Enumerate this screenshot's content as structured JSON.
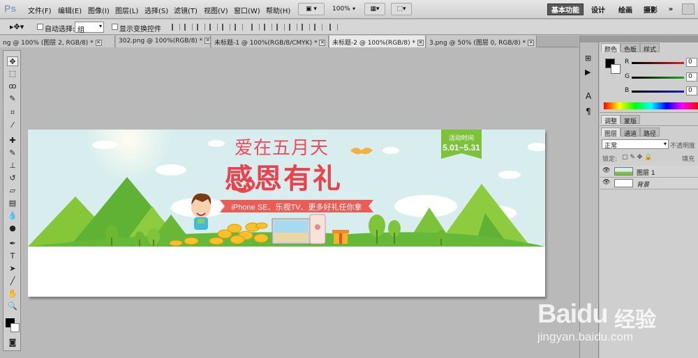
{
  "app": {
    "logo": "Ps"
  },
  "menu": [
    "文件(F)",
    "编辑(E)",
    "图像(I)",
    "图层(L)",
    "选择(S)",
    "滤镜(T)",
    "视图(V)",
    "窗口(W)",
    "帮助(H)"
  ],
  "menubar_controls": {
    "zoom": "100%"
  },
  "workspaces": [
    "基本功能",
    "设计",
    "绘画",
    "摄影",
    "»"
  ],
  "options": {
    "auto_select_label": "自动选择:",
    "auto_select_value": "组",
    "show_transform_label": "显示变换控件"
  },
  "tabs": [
    {
      "label": "ng @ 100% (图层 2, RGB/8) *",
      "active": false
    },
    {
      "label": "302.png @ 100%(RGB/8) *",
      "active": false
    },
    {
      "label": "未标题-1 @ 100%(RGB/8/CMYK) *",
      "active": false
    },
    {
      "label": "未标题-2 @ 100%(RGB/8) *",
      "active": true
    },
    {
      "label": "3.png @ 50% (图层 0, RGB/8) *",
      "active": false
    }
  ],
  "banner": {
    "line1": "爱在五月天",
    "line2": "感恩有礼",
    "ribbon": "iPhone SE、乐视TV、更多好礼任你拿",
    "badge_title": "活动时间",
    "badge_dates": "5.01~5.31"
  },
  "color_panel": {
    "tabs": [
      "颜色",
      "色板",
      "样式"
    ],
    "channels": [
      {
        "label": "R",
        "value": "0",
        "color": "#e41d1d"
      },
      {
        "label": "G",
        "value": "0",
        "color": "#1fa51f"
      },
      {
        "label": "B",
        "value": "0",
        "color": "#1c1cc8"
      }
    ]
  },
  "adjust_panel": {
    "tabs": [
      "调整",
      "蒙版"
    ]
  },
  "layers_panel": {
    "tabs": [
      "图层",
      "通道",
      "路径"
    ],
    "blend_mode": "正常",
    "opacity_label": "不透明度",
    "lock_label": "锁定:",
    "fill_label": "填充",
    "layers": [
      {
        "name": "图层 1",
        "italic": false
      },
      {
        "name": "背景",
        "italic": true
      }
    ]
  },
  "watermark": {
    "brand": "Baidu",
    "cn": "经验",
    "url": "jingyan.baidu.com"
  }
}
